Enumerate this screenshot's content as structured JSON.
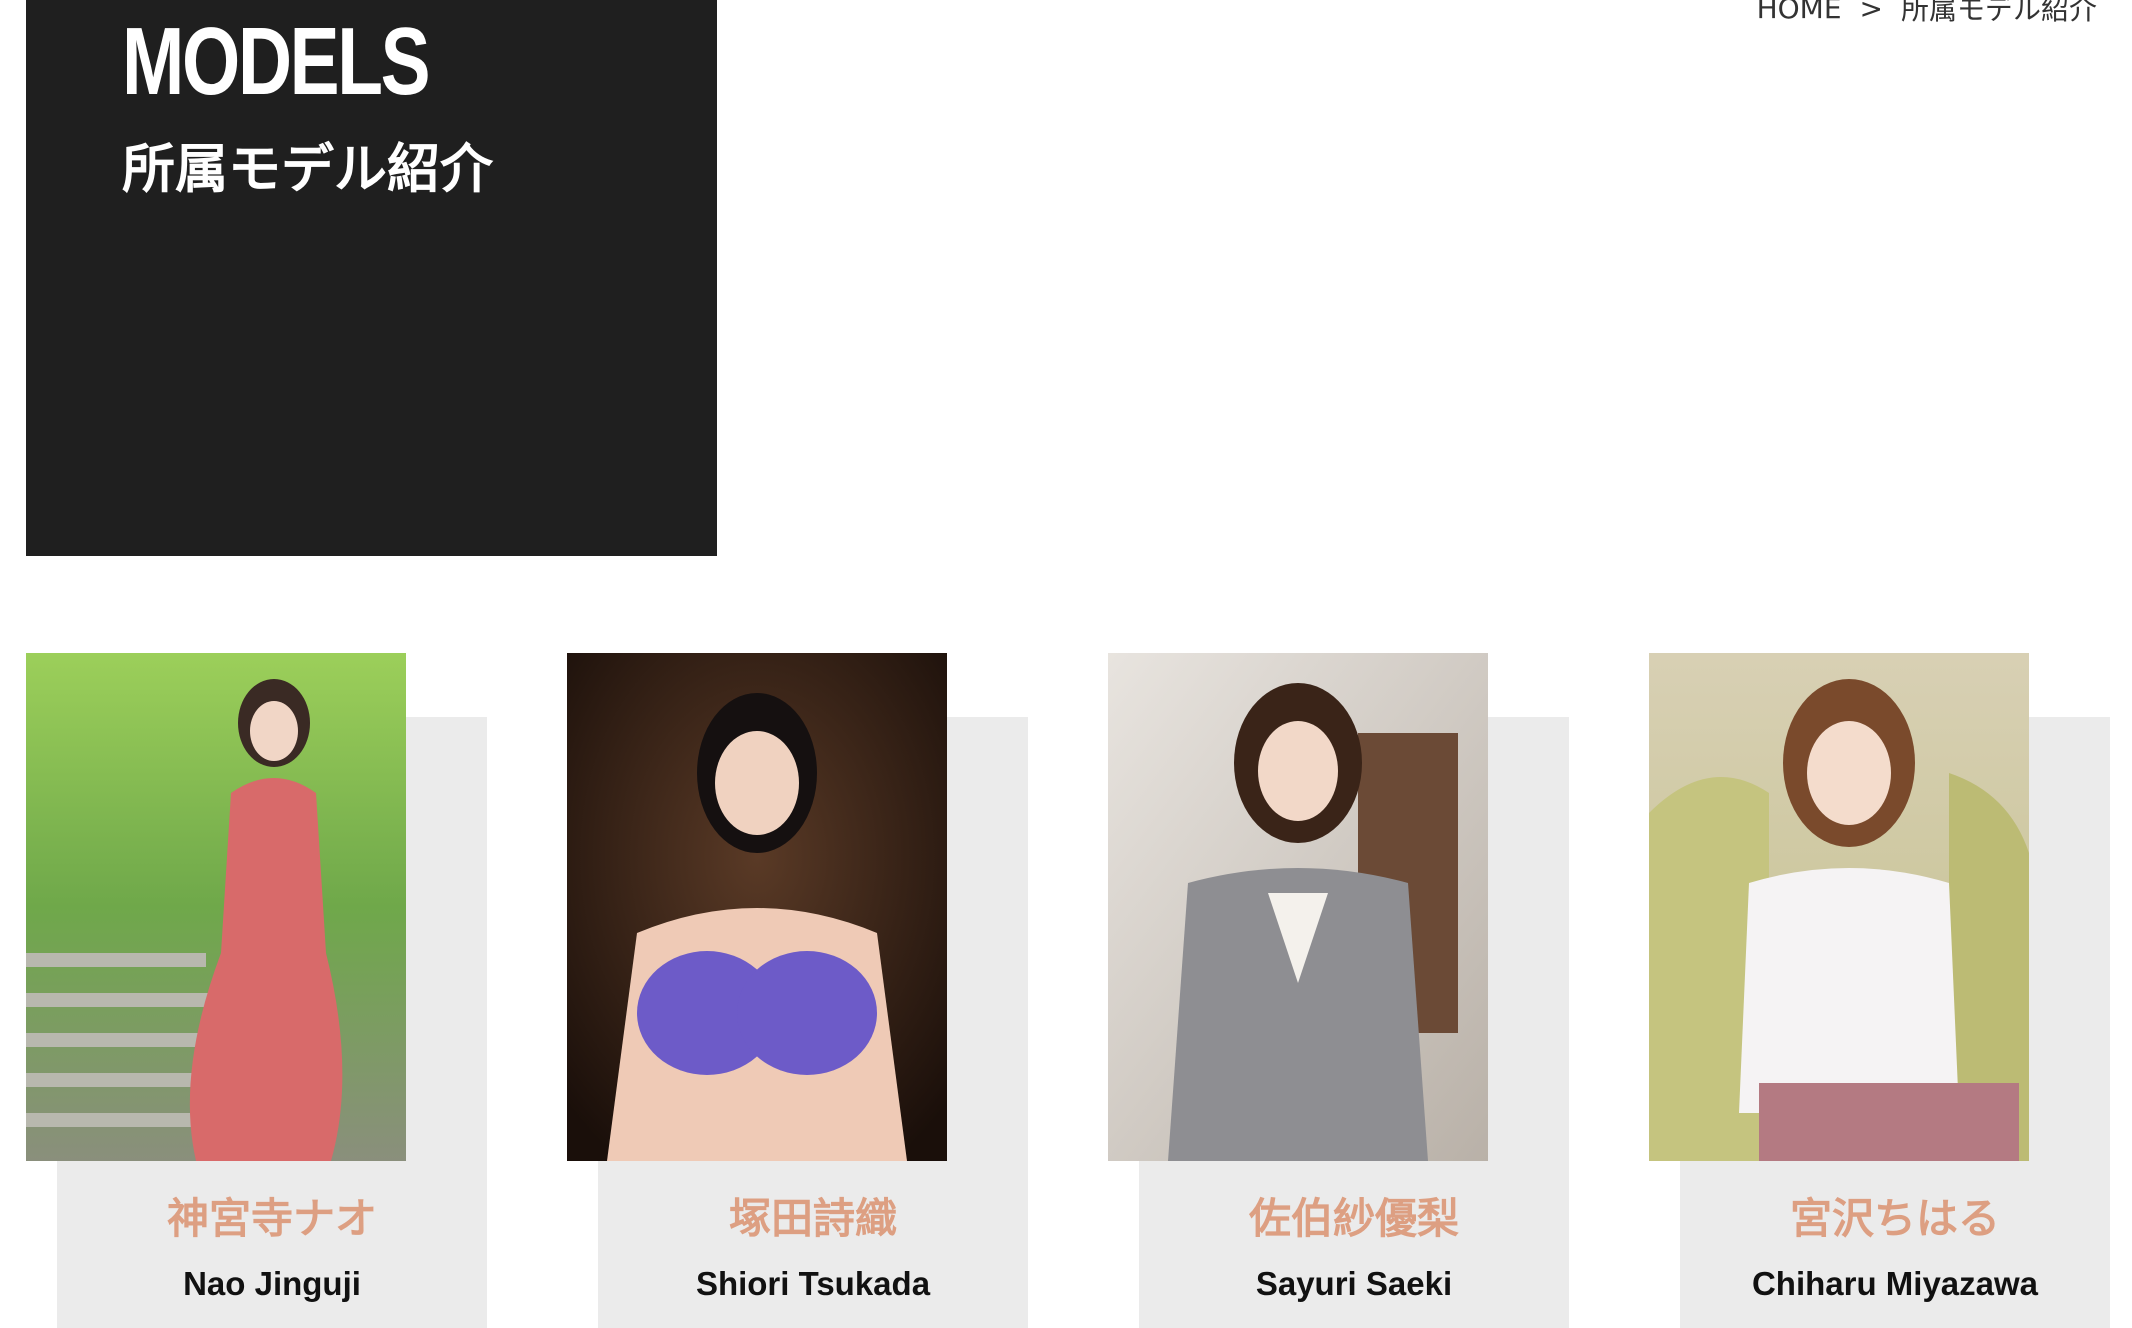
{
  "hero": {
    "title": "MODELS",
    "subtitle": "所属モデル紹介"
  },
  "breadcrumb": {
    "home": "HOME",
    "separator": ">",
    "current": "所属モデル紹介"
  },
  "models": [
    {
      "name_ja": "神宮寺ナオ",
      "name_en": "Nao Jinguji"
    },
    {
      "name_ja": "塚田詩織",
      "name_en": "Shiori Tsukada"
    },
    {
      "name_ja": "佐伯紗優梨",
      "name_en": "Sayuri Saeki"
    },
    {
      "name_ja": "宮沢ちはる",
      "name_en": "Chiharu Miyazawa"
    }
  ],
  "colors": {
    "hero_bg": "#1f1f1f",
    "card_bg": "#ebebeb",
    "name_ja": "#dd9f82",
    "name_en": "#111111"
  }
}
